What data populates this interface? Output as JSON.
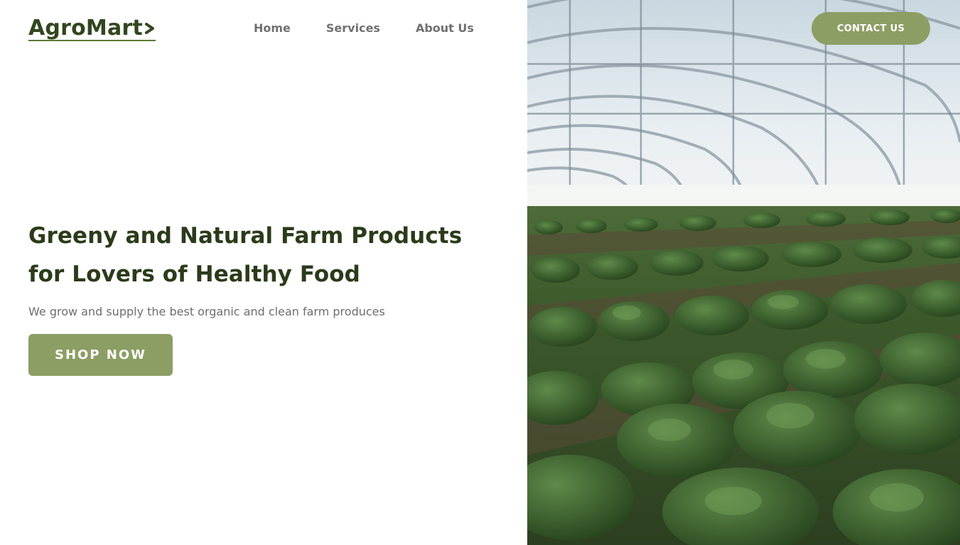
{
  "logo": {
    "text": "AgroMart"
  },
  "nav": {
    "items": [
      "Home",
      "Services",
      "About Us"
    ]
  },
  "header": {
    "contact_label": "CONTACT US"
  },
  "hero": {
    "title_line1": "Greeny and Natural Farm Products",
    "title_line2": "for Lovers of Healthy Food",
    "subtitle": "We grow and supply the best organic and clean farm produces",
    "cta_label": "SHOP NOW"
  },
  "colors": {
    "brand_dark": "#2b3b1a",
    "accent": "#8c9e64",
    "nav_text": "#707070"
  }
}
